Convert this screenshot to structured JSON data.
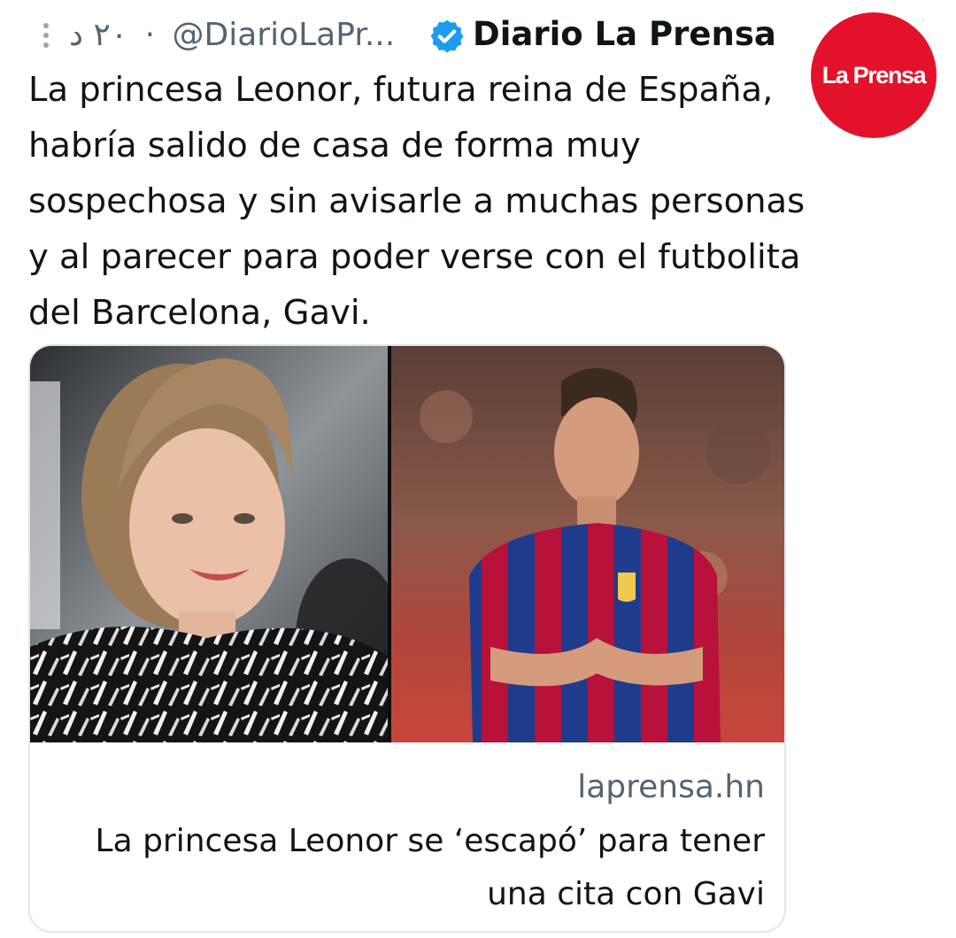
{
  "header": {
    "date": "٢٠ د",
    "separator": "·",
    "handle": "@DiarioLaPr...",
    "display_name": "Diario La Prensa",
    "avatar_text": "La Prensa",
    "more_icon": "more-vertical-icon",
    "verified_icon": "verified-badge-icon"
  },
  "tweet": {
    "text": "La princesa Leonor, futura reina de España, habría salido de casa de forma muy sospechosa y sin avisarle a muchas personas y al parecer para poder verse con el futbolita del Barcelona, Gavi."
  },
  "card": {
    "domain": "laprensa.hn",
    "title": "La princesa Leonor se ‘escapó’ para tener una cita con Gavi"
  },
  "colors": {
    "avatar_bg": "#e3122a",
    "verified": "#1d9bf0",
    "secondary_text": "#536471",
    "border": "#e3e7ea"
  }
}
